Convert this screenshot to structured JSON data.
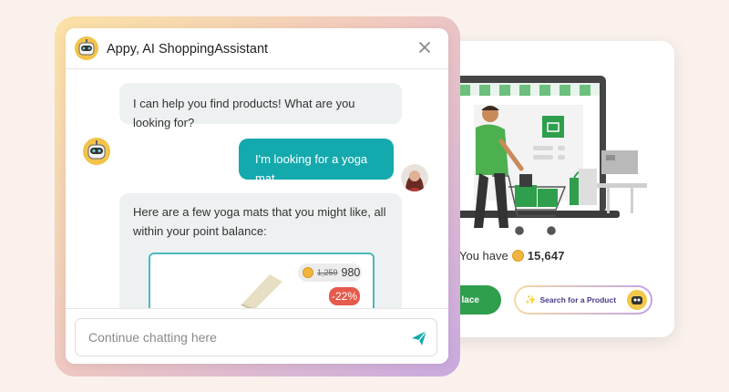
{
  "chat": {
    "title": "Appy, AI ShoppingAssistant",
    "messages": [
      {
        "role": "bot",
        "text": "I can help you find products! What are you looking for?"
      },
      {
        "role": "user",
        "text": "I'm looking for a yoga mat."
      },
      {
        "role": "bot",
        "text": "Here are a few yoga mats that you might like, all within your point balance:"
      }
    ],
    "product": {
      "old_price": "1,259",
      "new_price": "980",
      "discount": "-22%"
    },
    "input_placeholder": "Continue chatting here"
  },
  "store": {
    "balance_label": "You have",
    "balance_value": "15,647",
    "place_button": "lace",
    "search_button": "Search for a Product"
  },
  "colors": {
    "teal": "#14a9ad",
    "green": "#2f9e4d",
    "discount_red": "#e65a4b",
    "coin": "#f1b43f"
  },
  "icons": [
    "robot-avatar-icon",
    "close-icon",
    "send-icon",
    "coin-icon",
    "sparkle-icon"
  ]
}
